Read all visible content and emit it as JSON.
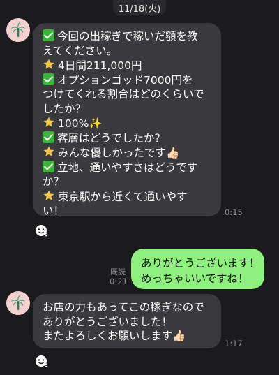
{
  "date_label": "11/18(火)",
  "messages": [
    {
      "lines": [
        {
          "icon": "check",
          "text": "今回の出稼ぎで稼いだ額を教"
        },
        {
          "icon": "",
          "text": "えてください。"
        },
        {
          "icon": "star",
          "text": "4日間211,000円"
        },
        {
          "icon": "check",
          "text": "オプションゴッド7000円を"
        },
        {
          "icon": "",
          "text": "つけてくれる割合はどのくらいで"
        },
        {
          "icon": "",
          "text": "したか？"
        },
        {
          "icon": "star",
          "text": "100%✨"
        },
        {
          "icon": "check",
          "text": "客層はどうでしたか？"
        },
        {
          "icon": "star",
          "text": "みんな優しかったです👍🏻"
        },
        {
          "icon": "check",
          "text": "立地、通いやすさはどうです"
        },
        {
          "icon": "",
          "text": "か？"
        },
        {
          "icon": "star",
          "text": "東京駅から近くて通いやす"
        },
        {
          "icon": "",
          "text": "い！"
        }
      ],
      "time": "0:15"
    },
    {
      "lines": [
        {
          "text": "ありがとうございます！"
        },
        {
          "text": "めっちゃいいですね！"
        }
      ],
      "read": "既読",
      "time": "0:21"
    },
    {
      "lines": [
        {
          "text": "お店の力もあってこの稼ぎなので"
        },
        {
          "text": "ありがとうございました！"
        },
        {
          "text": "またよろしくお願いします👍🏻"
        }
      ],
      "time": "1:17"
    }
  ],
  "colors": {
    "background": "#1b1b1d",
    "incoming_bubble": "#3a3a3d",
    "outgoing_bubble": "#8ff17d",
    "avatar_bg": "#f6d1d1",
    "check": "#3cb43c",
    "star": "#f2c94c"
  },
  "icons": {
    "avatar": "palm-tree-icon",
    "reaction": "smiley-reaction-icon"
  }
}
